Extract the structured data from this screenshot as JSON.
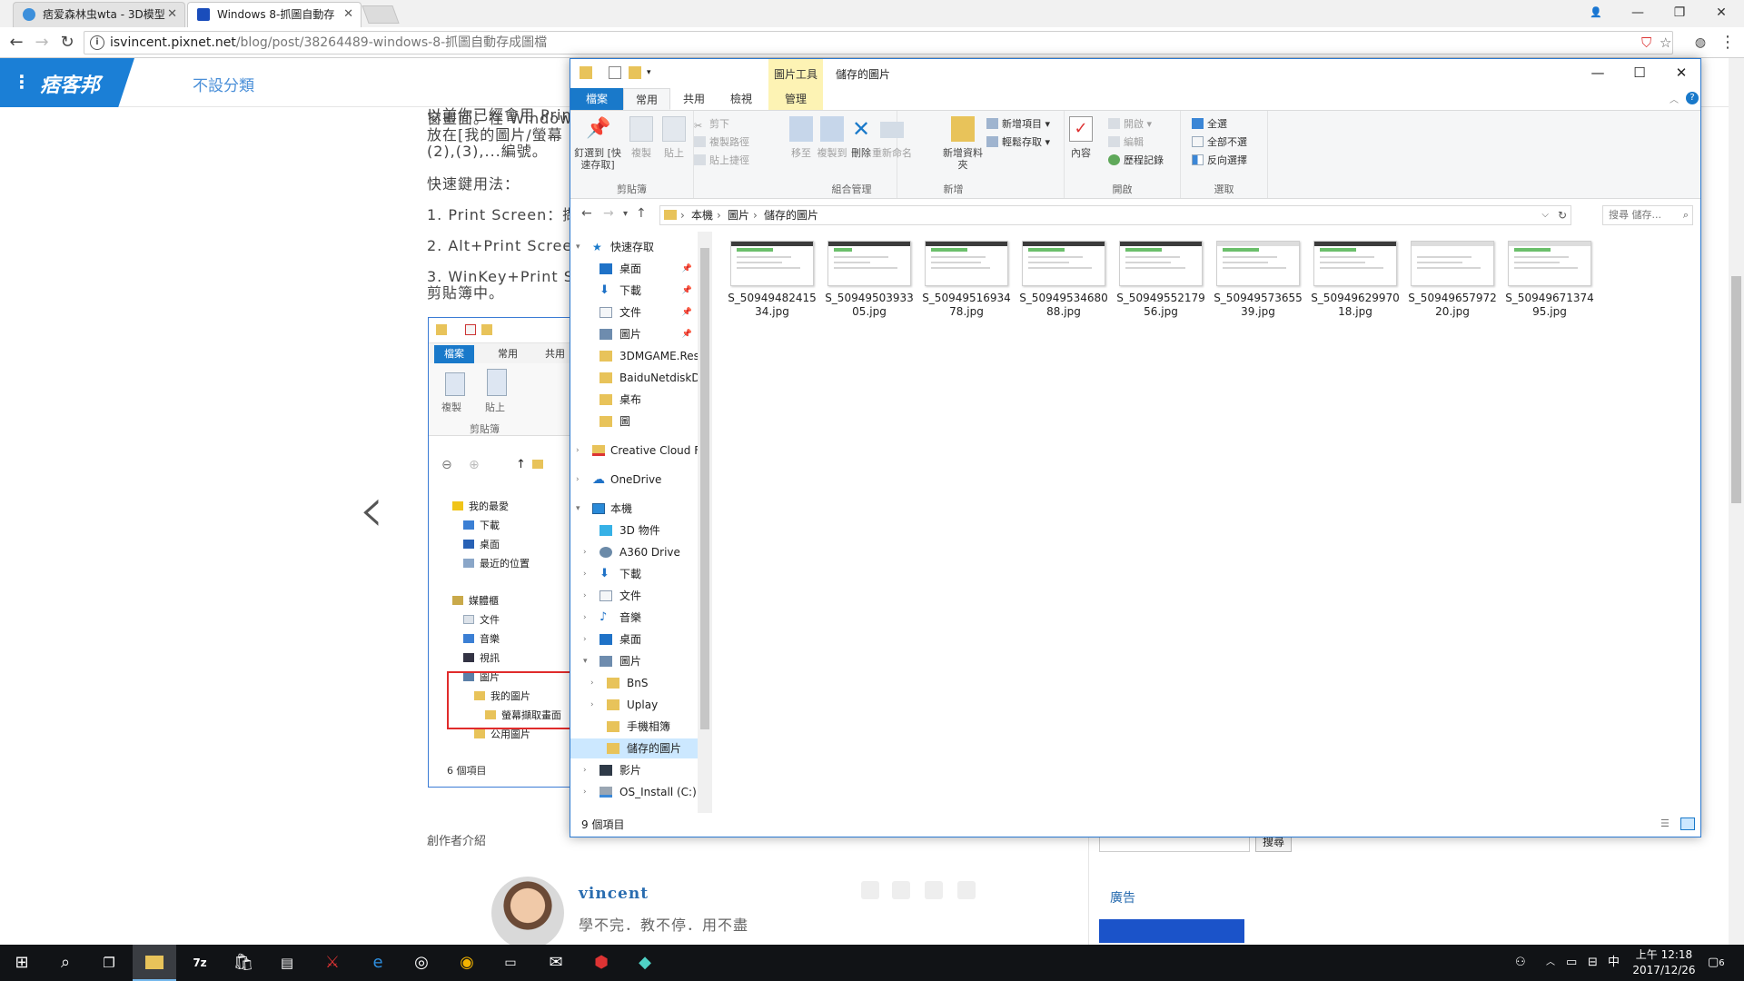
{
  "browser": {
    "tabs": [
      {
        "title": "痞爱森林虫wta - 3D模型",
        "icon_color": "#3c8fdb"
      },
      {
        "title": "Windows 8-抓圖自動存",
        "icon_color": "#1a4dbb"
      }
    ],
    "url_host": "isvincent.pixnet.net",
    "url_path": "/blog/post/38264489-windows-8-抓圖自動存成圖檔",
    "window_controls": {
      "user": "user-icon",
      "minimize": "—",
      "restore": "❐",
      "close": "✕"
    }
  },
  "site": {
    "brand": "痞客邦",
    "category_link": "不設分類"
  },
  "article": {
    "lines": [
      "以前你已經會用 Prin",
      "窗畫面。在 Window",
      "放在[我的圖片/螢幕",
      "(2),(3),...編號。",
      "快速鍵用法：",
      "1. Print Screen：擷",
      "2. Alt+Print Scree",
      "3. WinKey+Print S",
      "剪貼簿中。"
    ],
    "embedded_screenshot": {
      "tabs": [
        "檔案",
        "常用",
        "共用"
      ],
      "ribbon_buttons": [
        "複製",
        "貼上"
      ],
      "group_label": "剪貼簿",
      "tree": [
        "我的最愛",
        "下載",
        "桌面",
        "最近的位置",
        "媒體櫃",
        "文件",
        "音樂",
        "視訊",
        "圖片",
        "我的圖片",
        "螢幕擷取畫面",
        "公用圖片"
      ],
      "status": "6 個項目"
    },
    "author_section_label": "創作者介紹",
    "author_name": "vincent",
    "author_motto": "學不完．教不停．用不盡",
    "search_button": "搜尋",
    "ad_label": "廣告"
  },
  "explorer": {
    "title": "儲存的圖片",
    "context_tab_group": "圖片工具",
    "tabs": {
      "file": "檔案",
      "home": "常用",
      "share": "共用",
      "view": "檢視",
      "manage": "管理"
    },
    "ribbon": {
      "clipboard": {
        "label": "剪貼簿",
        "pin": "釘選到 [快速存取]",
        "copy": "複製",
        "paste": "貼上",
        "cut": "剪下",
        "copy_path": "複製路徑",
        "paste_shortcut": "貼上捷徑"
      },
      "organize": {
        "label": "組合管理",
        "move_to": "移至",
        "copy_to": "複製到",
        "delete": "刪除",
        "rename": "重新命名"
      },
      "new": {
        "label": "新增",
        "new_folder": "新增資料夾",
        "new_item": "新增項目",
        "easy_access": "輕鬆存取"
      },
      "open": {
        "label": "開啟",
        "properties": "內容",
        "open": "開啟",
        "edit": "編輯",
        "history": "歷程記錄"
      },
      "select": {
        "label": "選取",
        "select_all": "全選",
        "select_none": "全部不選",
        "invert": "反向選擇"
      }
    },
    "breadcrumb": [
      "本機",
      "圖片",
      "儲存的圖片"
    ],
    "search_placeholder": "搜尋 儲存...",
    "nav": [
      {
        "label": "快速存取",
        "icon": "star-icon",
        "pin": false
      },
      {
        "label": "桌面",
        "icon": "desktop-icon",
        "pin": true
      },
      {
        "label": "下載",
        "icon": "download-icon",
        "pin": true
      },
      {
        "label": "文件",
        "icon": "document-icon",
        "pin": true
      },
      {
        "label": "圖片",
        "icon": "pictures-icon",
        "pin": true
      },
      {
        "label": "3DMGAME.Res",
        "icon": "folder-icon",
        "pin": false
      },
      {
        "label": "BaiduNetdiskDo",
        "icon": "folder-icon",
        "pin": false
      },
      {
        "label": "桌布",
        "icon": "folder-icon",
        "pin": false
      },
      {
        "label": "圖",
        "icon": "folder-icon",
        "pin": false
      },
      {
        "label": "Creative Cloud Fi",
        "icon": "creative-cloud-icon",
        "pin": false
      },
      {
        "label": "OneDrive",
        "icon": "cloud-icon",
        "pin": false
      },
      {
        "label": "本機",
        "icon": "computer-icon",
        "pin": false
      },
      {
        "label": "3D 物件",
        "icon": "cube-icon",
        "pin": false
      },
      {
        "label": "A360 Drive",
        "icon": "drive-icon",
        "pin": false
      },
      {
        "label": "下載",
        "icon": "download-icon",
        "pin": false
      },
      {
        "label": "文件",
        "icon": "document-icon",
        "pin": false
      },
      {
        "label": "音樂",
        "icon": "music-icon",
        "pin": false
      },
      {
        "label": "桌面",
        "icon": "desktop-icon",
        "pin": false
      },
      {
        "label": "圖片",
        "icon": "pictures-icon",
        "pin": false
      },
      {
        "label": "BnS",
        "icon": "folder-icon",
        "pin": false
      },
      {
        "label": "Uplay",
        "icon": "folder-icon",
        "pin": false
      },
      {
        "label": "手機相簿",
        "icon": "folder-icon",
        "pin": false
      },
      {
        "label": "儲存的圖片",
        "icon": "folder-icon",
        "pin": false
      },
      {
        "label": "影片",
        "icon": "video-icon",
        "pin": false
      },
      {
        "label": "OS_Install (C:)",
        "icon": "drive-icon",
        "pin": false
      }
    ],
    "files": [
      {
        "line1": "S_50949482415",
        "line2": "34.jpg"
      },
      {
        "line1": "S_50949503933",
        "line2": "05.jpg"
      },
      {
        "line1": "S_50949516934",
        "line2": "78.jpg"
      },
      {
        "line1": "S_50949534680",
        "line2": "88.jpg"
      },
      {
        "line1": "S_50949552179",
        "line2": "56.jpg"
      },
      {
        "line1": "S_50949573655",
        "line2": "39.jpg"
      },
      {
        "line1": "S_50949629970",
        "line2": "18.jpg"
      },
      {
        "line1": "S_50949657972",
        "line2": "20.jpg"
      },
      {
        "line1": "S_50949671374",
        "line2": "95.jpg"
      }
    ],
    "status": "9 個項目"
  },
  "taskbar": {
    "clock_time": "上午 12:18",
    "clock_date": "2017/12/26",
    "ime": "中",
    "notifications": "6"
  },
  "colors": {
    "accent": "#1979ca",
    "context_tab": "#fdf3b4",
    "selection": "#cce8ff",
    "taskbar": "#111316",
    "brand": "#1b7fd6"
  }
}
